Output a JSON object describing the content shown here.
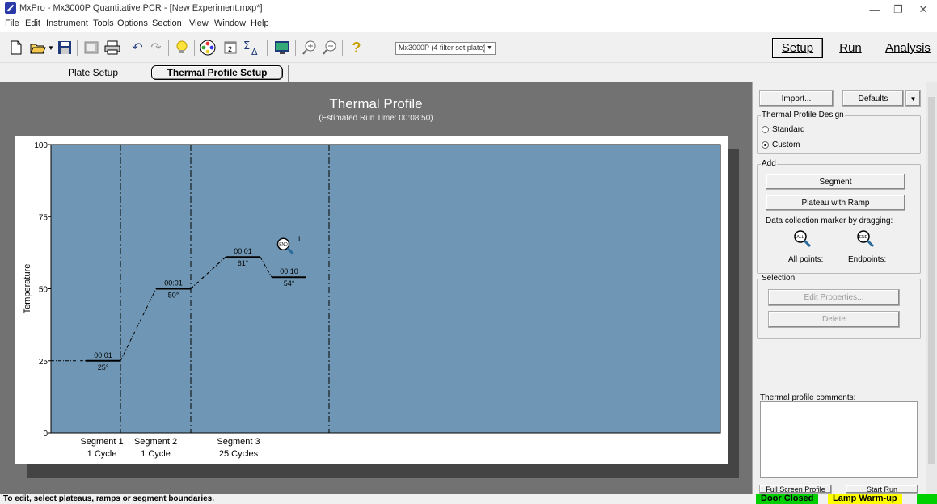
{
  "window": {
    "title": "MxPro - Mx3000P Quantitative PCR - [New Experiment.mxp*]",
    "minimize": "—",
    "restore": "❐",
    "close": "✕"
  },
  "menu": [
    "File",
    "Edit",
    "Instrument",
    "Tools",
    "Options",
    "Section",
    "View",
    "Window",
    "Help"
  ],
  "toolbar": {
    "instrument_select": "Mx3000P (4 filter set plate)",
    "modes": {
      "setup": "Setup",
      "run": "Run",
      "analysis": "Analysis"
    }
  },
  "tabs": {
    "plate_setup": "Plate Setup",
    "thermal_profile_setup": "Thermal Profile Setup"
  },
  "chart_data": {
    "type": "line",
    "title": "Thermal Profile",
    "subtitle": "(Estimated Run Time: 00:08:50)",
    "ylabel": "Temperature",
    "ylim": [
      0,
      100
    ],
    "yticks": [
      0,
      25,
      50,
      75,
      100
    ],
    "plot_background": "#6f97b5",
    "segments": [
      {
        "name": "Segment 1",
        "cycles": "1 Cycle",
        "plateaus": [
          {
            "time": "00:01",
            "temp": 25,
            "label": "25°"
          }
        ]
      },
      {
        "name": "Segment 2",
        "cycles": "1 Cycle",
        "plateaus": [
          {
            "time": "00:01",
            "temp": 50,
            "label": "50°"
          }
        ]
      },
      {
        "name": "Segment 3",
        "cycles": "25 Cycles",
        "plateaus": [
          {
            "time": "00:01",
            "temp": 61,
            "label": "61°"
          },
          {
            "time": "00:10",
            "temp": 54,
            "label": "54°",
            "marker": "end",
            "marker_label": "1"
          }
        ]
      }
    ]
  },
  "right_panel": {
    "import_label": "Import...",
    "defaults_label": "Defaults",
    "design_group": "Thermal Profile Design",
    "design_standard": "Standard",
    "design_custom": "Custom",
    "add_group": "Add",
    "segment_button": "Segment",
    "plateau_ramp_button": "Plateau with Ramp",
    "data_collection_label": "Data collection marker by dragging:",
    "all_points_label": "All points:",
    "endpoints_label": "Endpoints:",
    "marker_all_text": "ALL",
    "marker_end_text": "END",
    "selection_group": "Selection",
    "edit_properties_button": "Edit Properties...",
    "delete_button": "Delete",
    "comments_label": "Thermal profile comments:",
    "full_screen_button": "Full Screen Profile",
    "start_run_button": "Start Run"
  },
  "status": {
    "message": "To edit, select plateaus, ramps or segment boundaries.",
    "door": "Door Closed",
    "lamp": "Lamp Warm-up",
    "door_color": "#00d000",
    "lamp_color": "#ffff00"
  }
}
